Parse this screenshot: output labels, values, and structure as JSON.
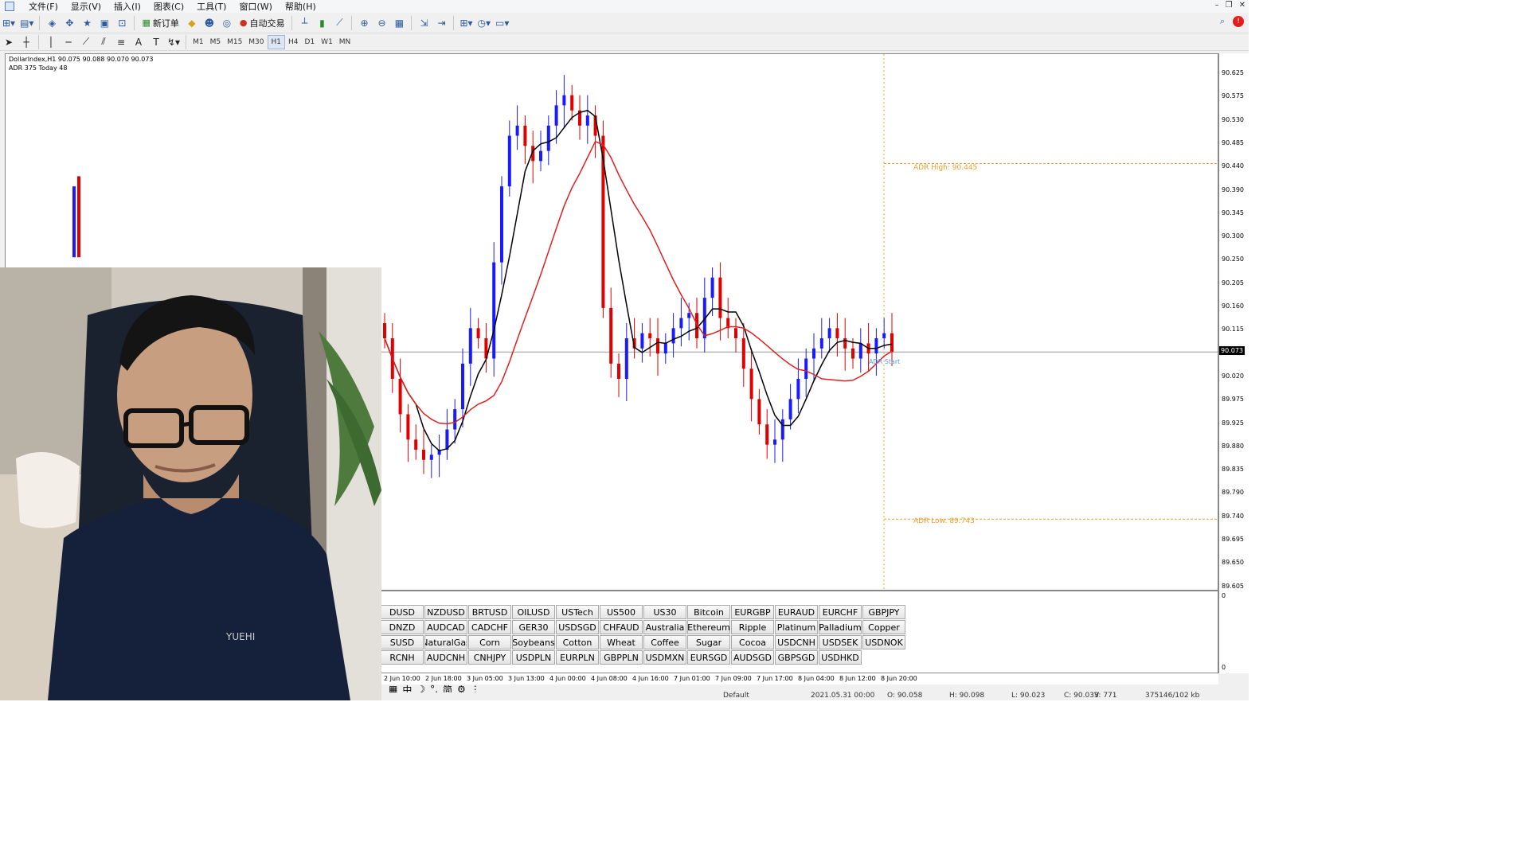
{
  "menu": {
    "items": [
      "文件(F)",
      "显示(V)",
      "插入(I)",
      "图表(C)",
      "工具(T)",
      "窗口(W)",
      "帮助(H)"
    ]
  },
  "toolbar": {
    "new_order": "新订单",
    "auto_trade": "自动交易"
  },
  "timeframes": [
    "M1",
    "M5",
    "M15",
    "M30",
    "H1",
    "H4",
    "D1",
    "W1",
    "MN"
  ],
  "timeframe_active": "H1",
  "chart": {
    "header": "DollarIndex,H1  90.075 90.088 90.070 90.073",
    "adr_line": "ADR 375  Today 48",
    "adr_high_label": "ADR High: 90.445",
    "adr_low_label": "ADR Low: 89.743",
    "adr_start_label": "ADR Start",
    "current_price": "90.073",
    "price_labels": [
      "90.625",
      "90.575",
      "90.530",
      "90.485",
      "90.440",
      "90.390",
      "90.345",
      "90.300",
      "90.250",
      "90.205",
      "90.160",
      "90.115",
      "90.020",
      "89.975",
      "89.925",
      "89.880",
      "89.835",
      "89.790",
      "89.740",
      "89.695",
      "89.650",
      "89.605"
    ],
    "lower_axis_top": "0",
    "lower_axis_bottom": "0",
    "time_labels": [
      "2 Jun 10:00",
      "2 Jun 18:00",
      "3 Jun 05:00",
      "3 Jun 13:00",
      "4 Jun 00:00",
      "4 Jun 08:00",
      "4 Jun 16:00",
      "7 Jun 01:00",
      "7 Jun 09:00",
      "7 Jun 17:00",
      "8 Jun 04:00",
      "8 Jun 12:00",
      "8 Jun 20:00"
    ],
    "colors": {
      "bull": "#1a1aff",
      "bear": "#e00000",
      "ma_fast": "#000000",
      "ma_slow": "#e02020",
      "adr": "#f0a030"
    }
  },
  "symbols": [
    [
      "DUSD",
      "NZDUSD",
      "BRTUSD",
      "OILUSD",
      "USTech",
      "US500",
      "US30",
      "Bitcoin",
      "EURGBP",
      "EURAUD",
      "EURCHF",
      "GBPJPY"
    ],
    [
      "DNZD",
      "AUDCAD",
      "CADCHF",
      "GER30",
      "USDSGD",
      "CHFAUD",
      "Australia",
      "Ethereum",
      "Ripple",
      "Platinum",
      "Palladium",
      "Copper"
    ],
    [
      "SUSD",
      "NaturalGas",
      "Corn",
      "Soybeans",
      "Cotton",
      "Wheat",
      "Coffee",
      "Sugar",
      "Cocoa",
      "USDCNH",
      "USDSEK",
      "USDNOK"
    ],
    [
      "RCNH",
      "AUDCNH",
      "CNHJPY",
      "USDPLN",
      "EURPLN",
      "GBPPLN",
      "USDMXN",
      "EURSGD",
      "AUDSGD",
      "GBPSGD",
      "USDHKD"
    ]
  ],
  "status": {
    "profile": "Default",
    "datetime": "2021.05.31 00:00",
    "open": "O: 90.058",
    "high": "H: 90.098",
    "low": "L: 90.023",
    "close": "C: 90.033",
    "volume": "V: 771",
    "traffic": "375146/102 kb"
  },
  "webcam": {
    "shirt_text": "YUEHI"
  }
}
